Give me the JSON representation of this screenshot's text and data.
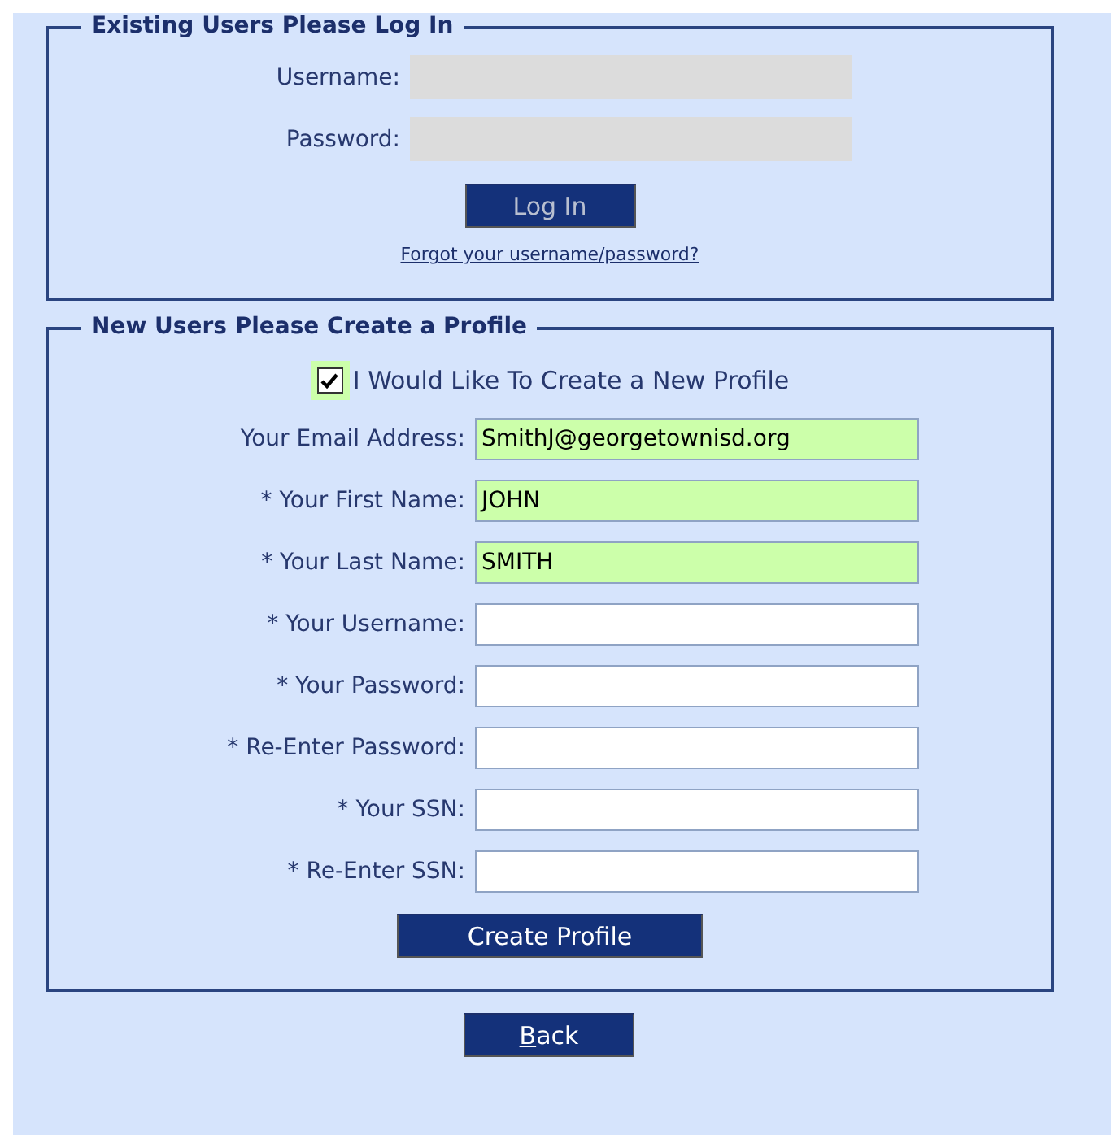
{
  "login": {
    "legend": "Existing Users Please Log In",
    "fields": [
      {
        "label": "Username:",
        "disabled": true
      },
      {
        "label": "Password:",
        "disabled": true
      }
    ],
    "button": {
      "label": "Log In",
      "disabled": true
    },
    "link": "Forgot your username/password?"
  },
  "profile": {
    "legend": "New Users Please Create a Profile",
    "checkbox": {
      "label": "I Would Like To Create a New Profile",
      "checked": true
    },
    "fields": [
      {
        "label": "Your Email Address:",
        "value": "SmithJ@georgetownisd.org",
        "highlighted": true
      },
      {
        "label": "* Your First Name:",
        "value": "JOHN",
        "highlighted": true
      },
      {
        "label": "* Your Last Name:",
        "value": "SMITH",
        "highlighted": true
      },
      {
        "label": "* Your Username:",
        "highlighted": false
      },
      {
        "label": "* Your Password:",
        "highlighted": false
      },
      {
        "label": "* Re-Enter Password:",
        "highlighted": false
      },
      {
        "label": "* Your SSN:",
        "highlighted": false
      },
      {
        "label": "* Re-Enter SSN:",
        "highlighted": false
      }
    ],
    "button": {
      "label": "Create Profile",
      "disabled": false
    }
  },
  "back_button": {
    "label": "Back",
    "access_key_underlined": true,
    "disabled": false
  }
}
